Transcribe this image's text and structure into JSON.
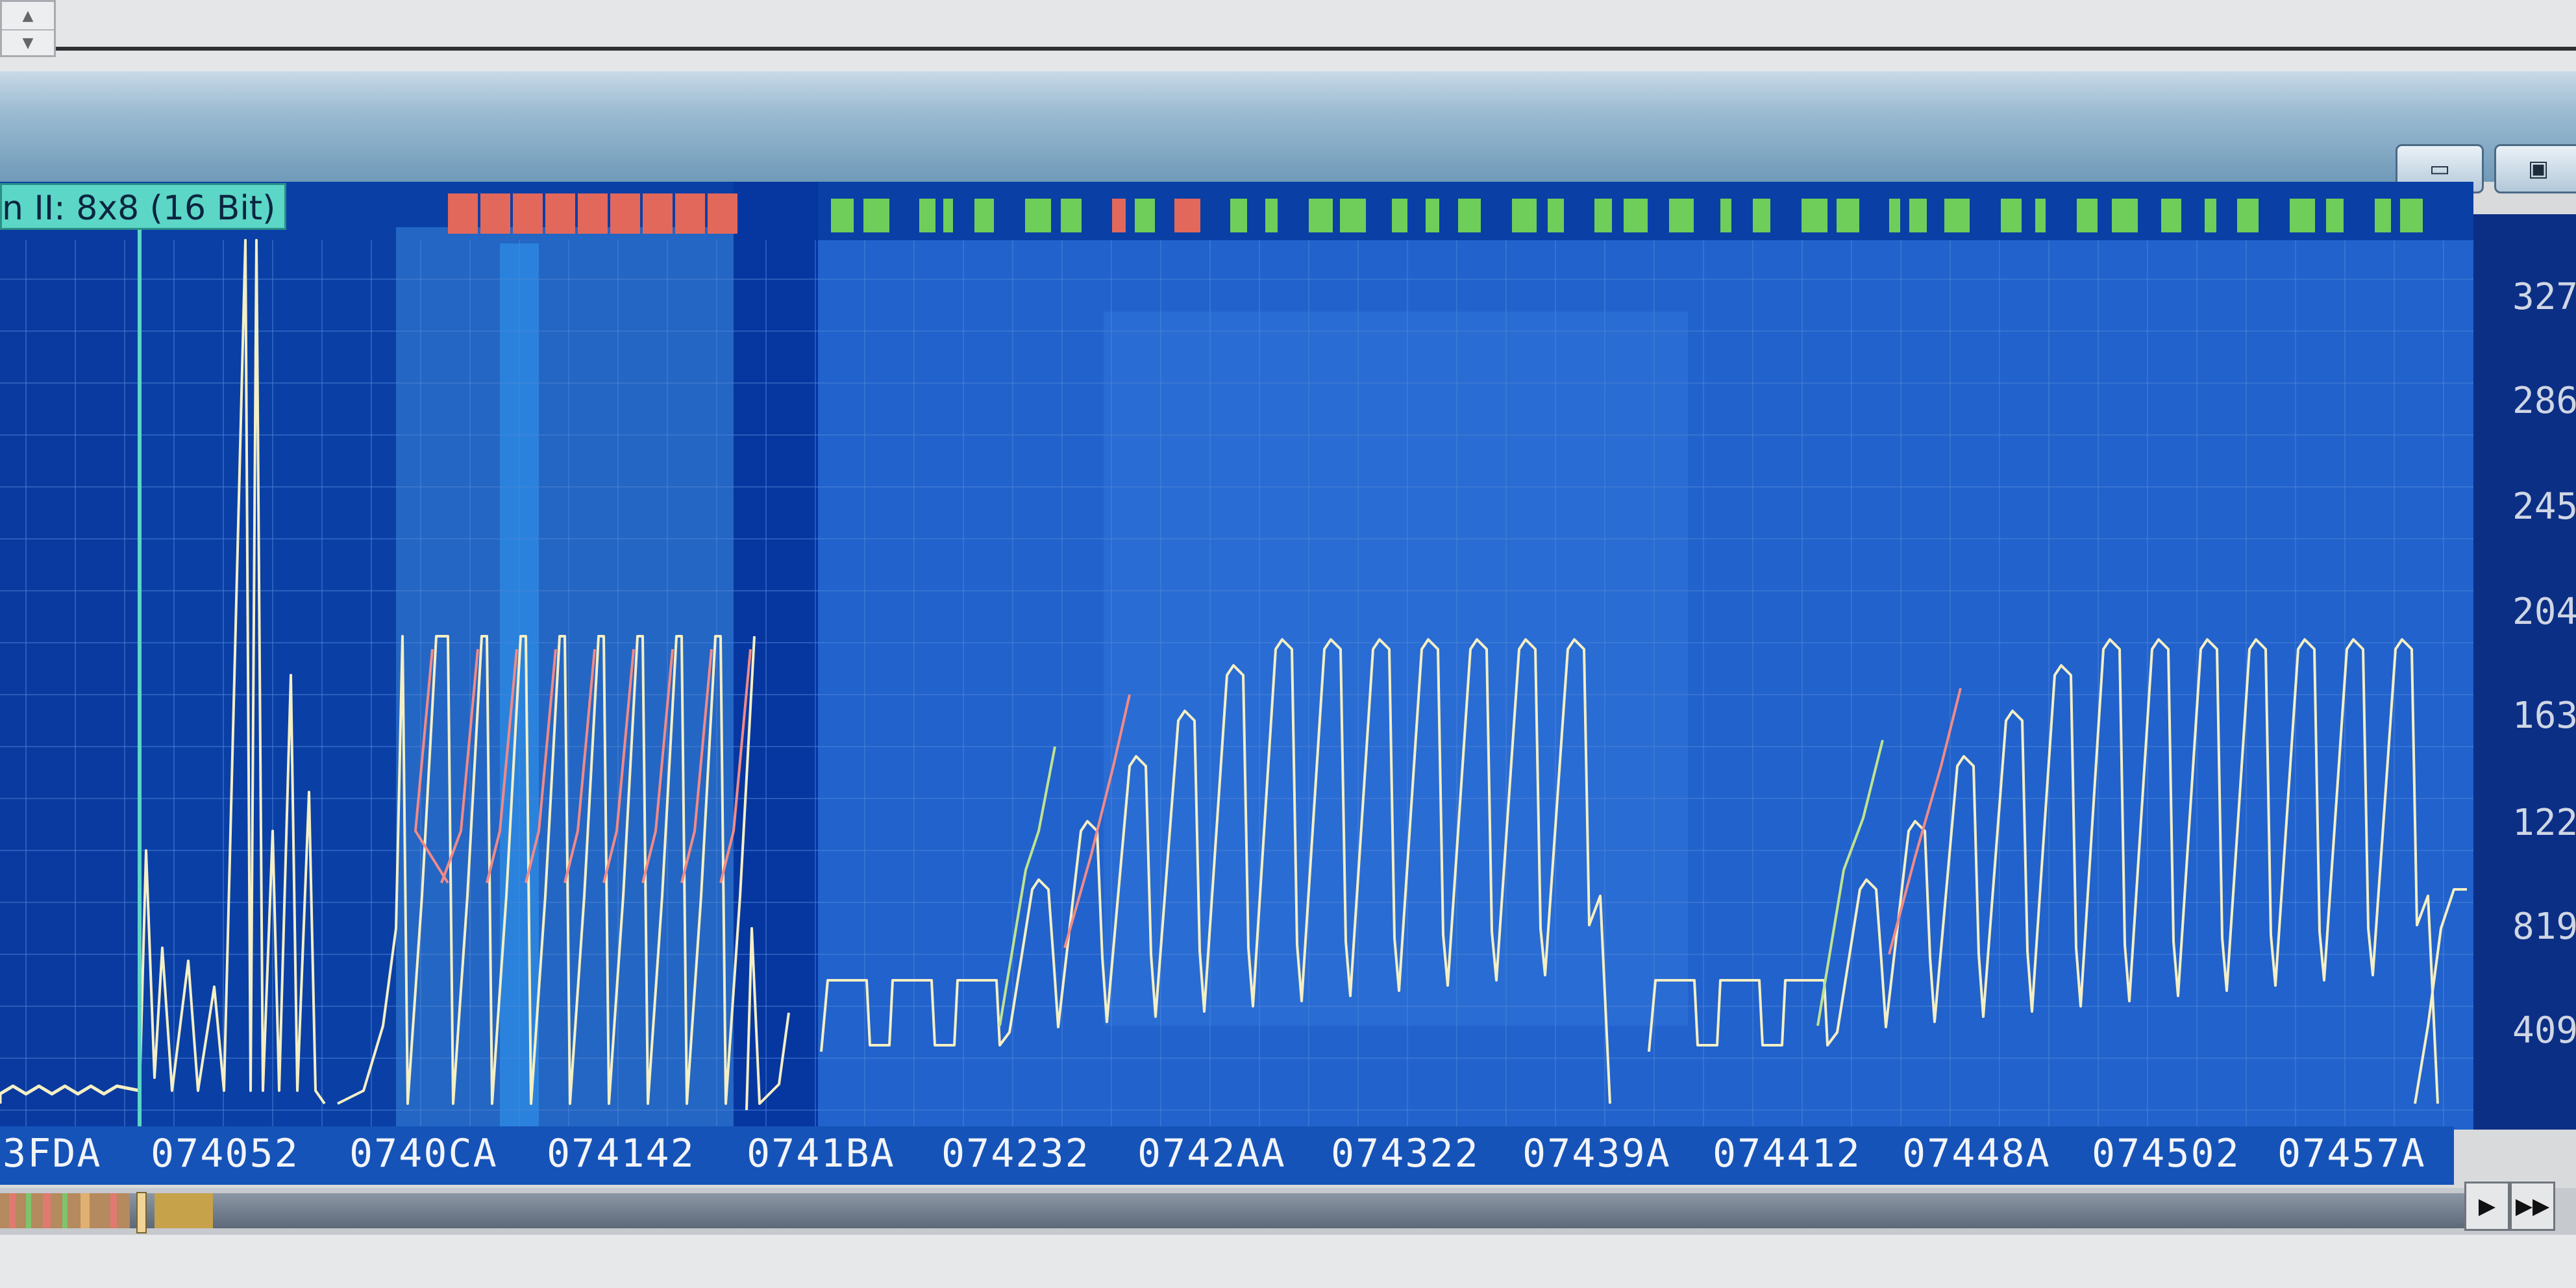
{
  "header": {
    "spinner_up": "▲",
    "spinner_down": "▼",
    "minimize_glyph": "▭",
    "maximize_glyph": "▣"
  },
  "channel_label": "n II: 8x8 (16 Bit)",
  "y_axis": {
    "tick_labels": [
      "327",
      "286",
      "245",
      "204",
      "163",
      "122",
      "819",
      "409"
    ]
  },
  "x_axis": {
    "tick_labels": [
      "3FDA",
      "074052",
      "0740CA",
      "074142",
      "0741BA",
      "074232",
      "0742AA",
      "074322",
      "07439A",
      "074412",
      "07448A",
      "074502",
      "07457A"
    ]
  },
  "scrollbar": {
    "play_glyph": "▶",
    "fast_forward_glyph": "▶▶"
  },
  "colors": {
    "plot_background": "#0a3fa6",
    "highlight_region": "#3a86db",
    "selection_region": "#1a5cc4",
    "waveform_light": "#f4efc4",
    "waveform_red": "#f28a86",
    "waveform_green": "#bfe38f",
    "marker_red": "#e2685c",
    "marker_green": "#6fcd5a",
    "cursor_cyan": "#5cd6c6"
  },
  "icons": {
    "spinner_up": "triangle-up-icon",
    "spinner_down": "triangle-down-icon",
    "minimize": "minimize-icon",
    "maximize": "maximize-icon",
    "play": "play-icon",
    "fast_forward": "fast-forward-icon"
  }
}
